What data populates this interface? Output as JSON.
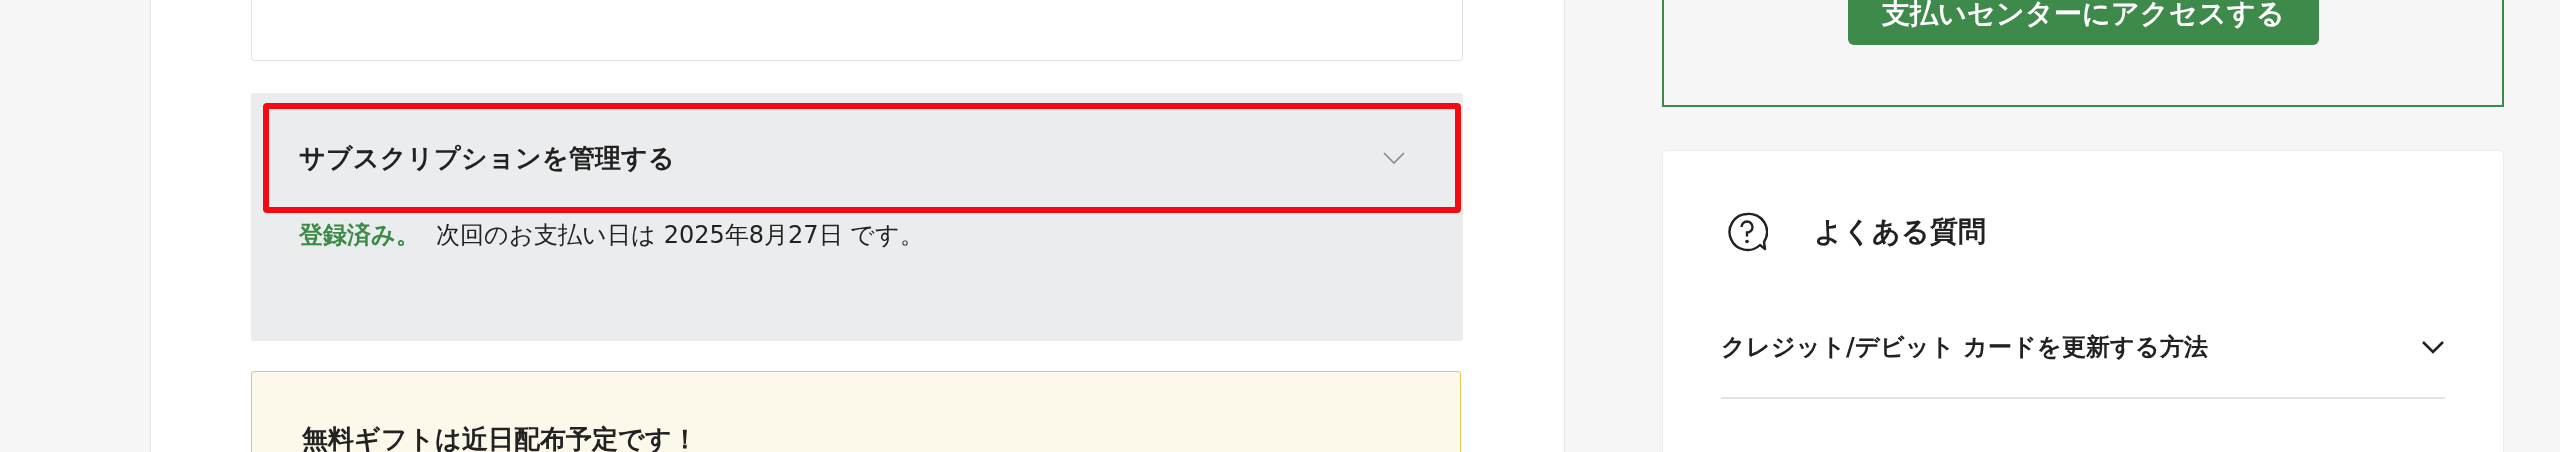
{
  "subscription_panel": {
    "title": "サブスクリプションを管理する",
    "expanded": false,
    "highlighted": true,
    "status": "登録済み。",
    "message": "次回のお支払い日は 2025年8月27日 です。"
  },
  "gift_notice": {
    "title": "無料ギフトは近日配布予定です！"
  },
  "payment_center": {
    "button": "支払いセンターにアクセスする"
  },
  "faq": {
    "title": "よくある質問",
    "items": [
      {
        "question": "クレジット/デビット カードを更新する方法",
        "expanded": false
      }
    ]
  }
}
